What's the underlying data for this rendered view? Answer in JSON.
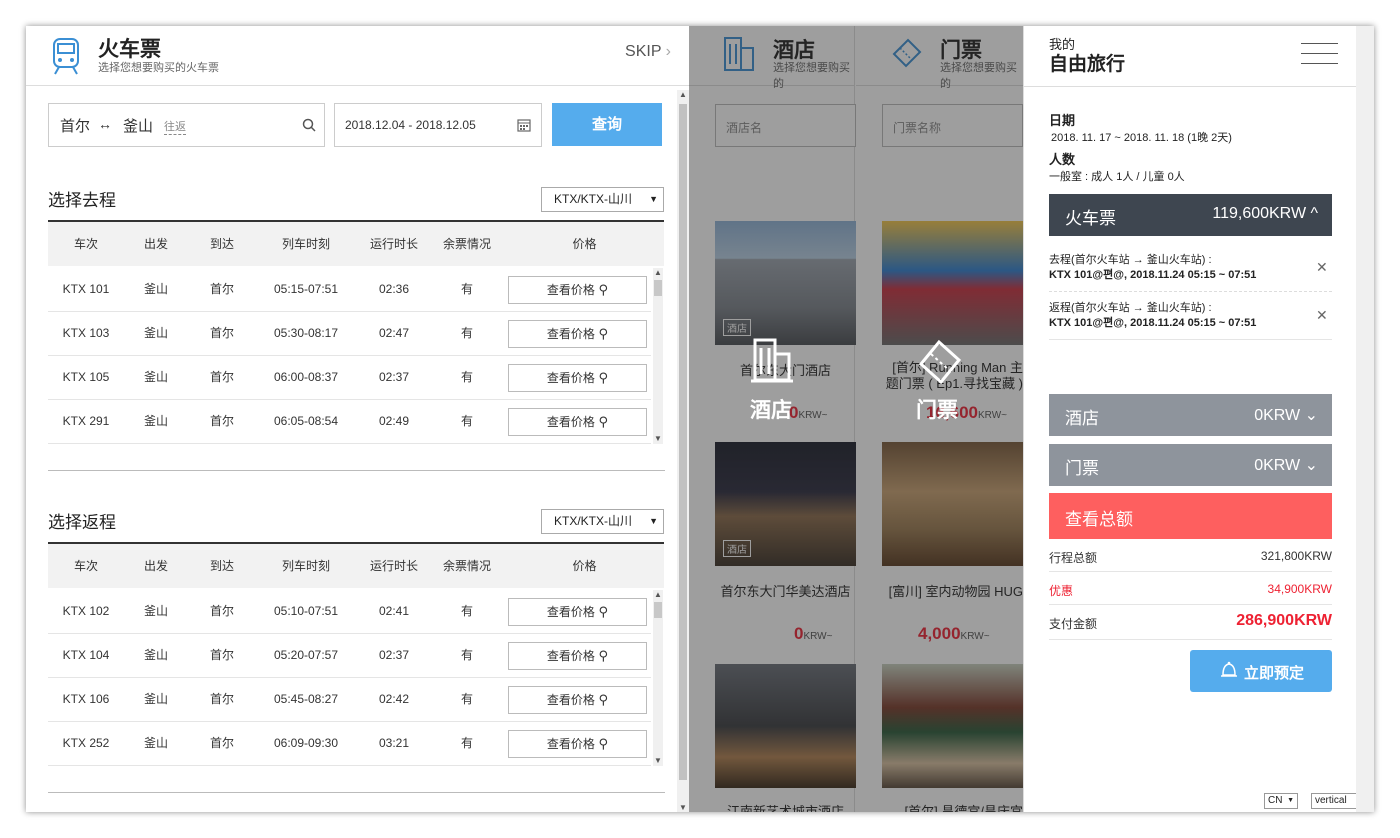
{
  "train": {
    "title": "火车票",
    "subtitle": "选择您想要购买的火车票",
    "skip": "SKIP"
  },
  "search": {
    "from": "首尔",
    "swap": "↔",
    "to": "釜山",
    "trip_type": "往返",
    "dates": "2018.12.04 - 2018.12.05",
    "button": "查询"
  },
  "outbound": {
    "title": "选择去程",
    "filter": "KTX/KTX-山川"
  },
  "return": {
    "title": "选择返程",
    "filter": "KTX/KTX-山川"
  },
  "columns": [
    "车次",
    "出发",
    "到达",
    "列车时刻",
    "运行时长",
    "余票情况",
    "价格"
  ],
  "price_button": "查看价格",
  "outbound_rows": [
    {
      "train": "KTX 101",
      "from": "釜山",
      "to": "首尔",
      "time": "05:15-07:51",
      "dur": "02:36",
      "avail": "有"
    },
    {
      "train": "KTX 103",
      "from": "釜山",
      "to": "首尔",
      "time": "05:30-08:17",
      "dur": "02:47",
      "avail": "有"
    },
    {
      "train": "KTX 105",
      "from": "釜山",
      "to": "首尔",
      "time": "06:00-08:37",
      "dur": "02:37",
      "avail": "有"
    },
    {
      "train": "KTX 291",
      "from": "釜山",
      "to": "首尔",
      "time": "06:05-08:54",
      "dur": "02:49",
      "avail": "有"
    }
  ],
  "return_rows": [
    {
      "train": "KTX 102",
      "from": "釜山",
      "to": "首尔",
      "time": "05:10-07:51",
      "dur": "02:41",
      "avail": "有"
    },
    {
      "train": "KTX 104",
      "from": "釜山",
      "to": "首尔",
      "time": "05:20-07:57",
      "dur": "02:37",
      "avail": "有"
    },
    {
      "train": "KTX 106",
      "from": "釜山",
      "to": "首尔",
      "time": "05:45-08:27",
      "dur": "02:42",
      "avail": "有"
    },
    {
      "train": "KTX 252",
      "from": "釜山",
      "to": "首尔",
      "time": "06:09-09:30",
      "dur": "03:21",
      "avail": "有"
    }
  ],
  "hotel": {
    "title": "酒店",
    "subtitle": "选择您想要购买的",
    "placeholder": "酒店名",
    "big_label": "酒店",
    "badge": "酒店",
    "items": [
      {
        "name": "首尔东大门酒店",
        "price": "0",
        "unit": "KRW~"
      },
      {
        "name": "首尔东大门华美达酒店",
        "price": "0",
        "unit": "KRW~"
      },
      {
        "name": "江南新艺术城市酒店",
        "price": "",
        "unit": ""
      }
    ]
  },
  "ticket": {
    "title": "门票",
    "subtitle": "选择您想要购买的",
    "placeholder": "门票名称",
    "big_label": "门票",
    "items": [
      {
        "name": "[首尔] Running Man 主题门票 ( Ep1.寻找宝藏 )",
        "price": "16,600",
        "unit": "KRW~"
      },
      {
        "name": "[富川] 室内动物园 HUG",
        "price": "4,000",
        "unit": "KRW~"
      },
      {
        "name": "[首尔] 昌德宫/昌庆宫",
        "price": "",
        "unit": ""
      }
    ]
  },
  "summary": {
    "my": "我的",
    "title": "自由旅行",
    "date_label": "日期",
    "date_value": "2018. 11. 17 ~ 2018. 11. 18 (1晚 2天)",
    "people_label": "人数",
    "people_value": "一般室 : 成人 1人 / 儿童 0人",
    "train_bar": {
      "label": "火车票",
      "amount": "119,600KRW ^"
    },
    "outbound_line1": "去程(首尔火车站 → 釜山火车站) :",
    "outbound_line2": "KTX 101@편@, 2018.11.24 05:15 ~ 07:51",
    "return_line1": "返程(首尔火车站 → 釜山火车站) :",
    "return_line2": "KTX 101@편@, 2018.11.24 05:15 ~ 07:51",
    "hotel_bar": {
      "label": "酒店",
      "amount": "0KRW ⌄"
    },
    "ticket_bar": {
      "label": "门票",
      "amount": "0KRW ⌄"
    },
    "total_bar": "查看总额",
    "total_label": "行程总额",
    "total_value": "321,800KRW",
    "discount_label": "优惠",
    "discount_value": "34,900KRW",
    "pay_label": "支付金额",
    "pay_value": "286,900KRW",
    "book": "立即预定"
  },
  "footer": {
    "lang": "CN",
    "layout": "vertical"
  },
  "colors": {
    "accent": "#55aced",
    "dark_bar": "#3e4650",
    "grey_bar": "#8e949c",
    "red": "#fe5f5f"
  }
}
